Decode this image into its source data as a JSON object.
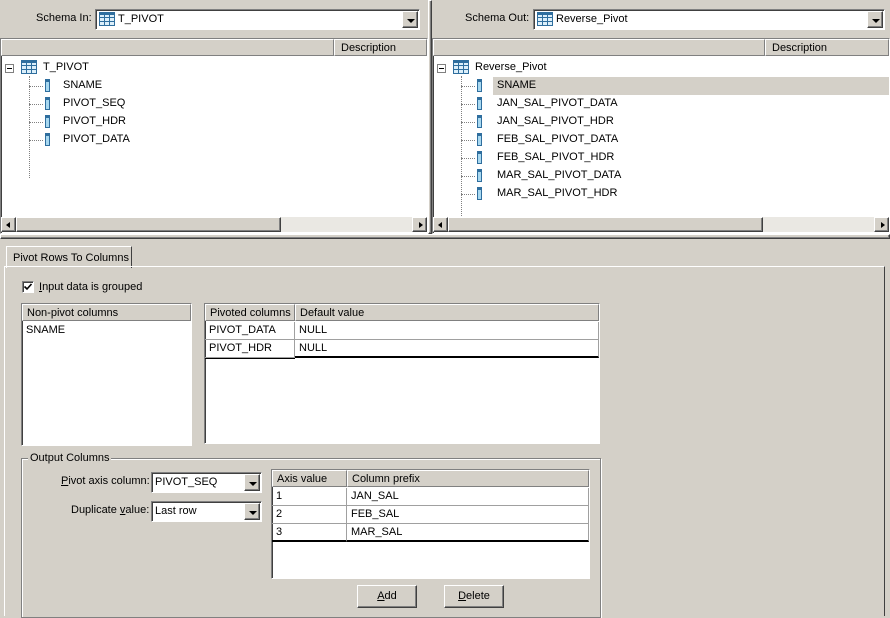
{
  "schema_in": {
    "label": "Schema In:",
    "value": "T_PIVOT",
    "column_header": "Description",
    "root": "T_PIVOT",
    "columns": [
      "SNAME",
      "PIVOT_SEQ",
      "PIVOT_HDR",
      "PIVOT_DATA"
    ]
  },
  "schema_out": {
    "label": "Schema Out:",
    "value": "Reverse_Pivot",
    "column_header": "Description",
    "root": "Reverse_Pivot",
    "columns": [
      "SNAME",
      "JAN_SAL_PIVOT_DATA",
      "JAN_SAL_PIVOT_HDR",
      "FEB_SAL_PIVOT_DATA",
      "FEB_SAL_PIVOT_HDR",
      "MAR_SAL_PIVOT_DATA",
      "MAR_SAL_PIVOT_HDR"
    ],
    "selected": "SNAME"
  },
  "tab": {
    "label": "Pivot Rows To Columns"
  },
  "grouped_checkbox": {
    "label_rest": "nput data is grouped",
    "mnemonic": "I",
    "checked": true
  },
  "non_pivot": {
    "header": "Non-pivot columns",
    "items": [
      "SNAME"
    ]
  },
  "pivoted": {
    "headers": [
      "Pivoted columns",
      "Default value"
    ],
    "rows": [
      [
        "PIVOT_DATA",
        "NULL"
      ],
      [
        "PIVOT_HDR",
        "NULL"
      ]
    ]
  },
  "output_columns": {
    "title": "Output Columns",
    "pivot_axis_label_mnemonic": "P",
    "pivot_axis_label_rest": "ivot axis column:",
    "pivot_axis_value": "PIVOT_SEQ",
    "duplicate_label_pre": "Duplicate ",
    "duplicate_label_mnemonic": "v",
    "duplicate_label_rest": "alue:",
    "duplicate_value": "Last row",
    "axis_headers": [
      "Axis value",
      "Column prefix"
    ],
    "axis_rows": [
      [
        "1",
        "JAN_SAL"
      ],
      [
        "2",
        "FEB_SAL"
      ],
      [
        "3",
        "MAR_SAL"
      ]
    ],
    "add_mnemonic": "A",
    "add_rest": "dd",
    "delete_mnemonic": "D",
    "delete_rest": "elete"
  },
  "colors": {
    "face": "#d4d0c8",
    "selected_row": "#d4d0c8"
  }
}
